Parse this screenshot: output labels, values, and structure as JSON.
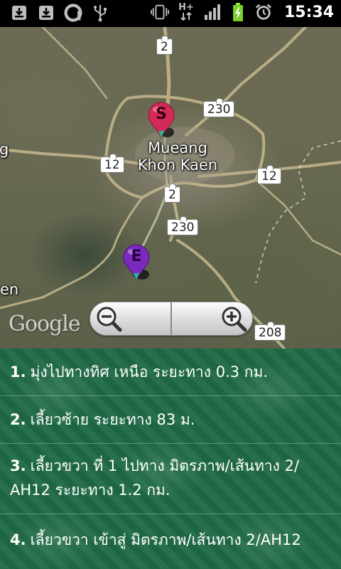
{
  "status_bar": {
    "time": "15:34",
    "network_label": "H+",
    "left_icons": [
      "download-icon",
      "download-icon",
      "app-a-icon",
      "usb-icon"
    ],
    "right_icons": [
      "vibrate-icon",
      "network-hplus-icon",
      "signal-icon",
      "battery-charging-icon",
      "alarm-icon"
    ]
  },
  "map": {
    "place_label_line1": "Mueang",
    "place_label_line2": "Khon Kaen",
    "edge_label_left_top": "g",
    "edge_label_left_bottom": "en",
    "start_marker_letter": "S",
    "end_marker_letter": "E",
    "road_shields": [
      "2",
      "230",
      "12",
      "12",
      "2",
      "230",
      "208"
    ],
    "logo_text": "Google",
    "colors": {
      "start_marker": "#d42a5a",
      "end_marker": "#7a2bbd",
      "pin_tip": "#2bb39a"
    }
  },
  "directions": [
    {
      "number": "1.",
      "text": "มุ่งไปทางทิศ เหนือ ระยะทาง 0.3 กม."
    },
    {
      "number": "2.",
      "text": "เลี้ยวซ้าย ระยะทาง 83 ม."
    },
    {
      "number": "3.",
      "text": "เลี้ยวขวา ที่ 1 ไปทาง มิตรภาพ/เส้นทาง 2/",
      "text_line2": "AH12 ระยะทาง 1.2 กม."
    },
    {
      "number": "4.",
      "text": "เลี้ยวขวา เข้าสู่ มิตรภาพ/เส้นทาง 2/AH12"
    }
  ]
}
